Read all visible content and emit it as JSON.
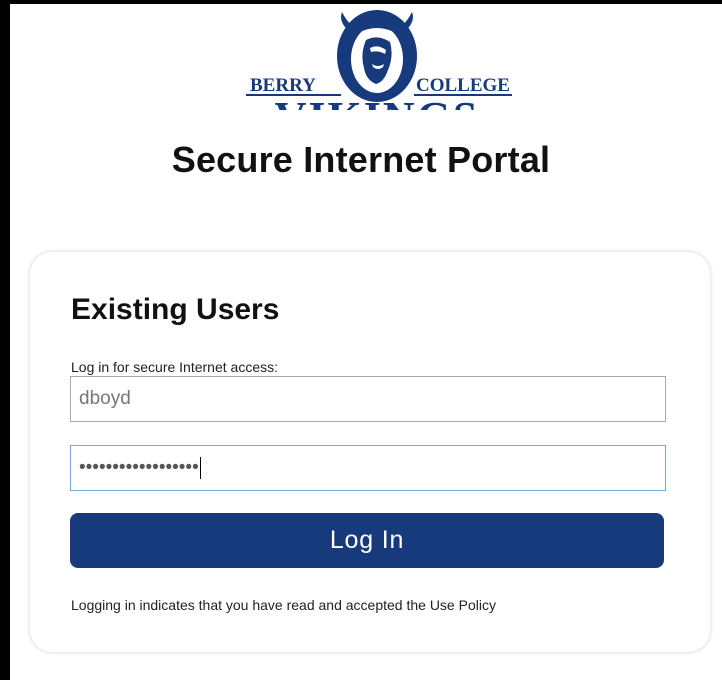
{
  "logo": {
    "left_text": "BERRY",
    "right_text": "COLLEGE",
    "bottom_text": "VIKINGS",
    "color": "#173a7d"
  },
  "page": {
    "title": "Secure Internet Portal"
  },
  "login_card": {
    "heading": "Existing Users",
    "instruction": "Log in for secure Internet access:",
    "username_value": "dboyd",
    "password_value": "••••••••••••••••••",
    "login_button_label": "Log In",
    "policy_text": "Logging in indicates that you have read and accepted the Use Policy"
  },
  "colors": {
    "accent": "#173a7d",
    "focus_border": "#7ba8dc",
    "frame": "#000000"
  }
}
